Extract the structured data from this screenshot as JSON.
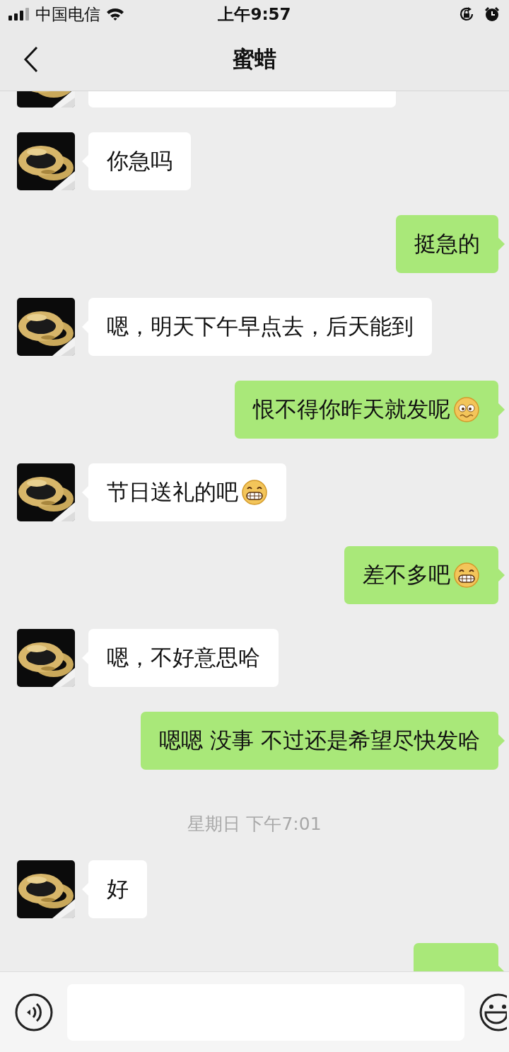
{
  "status_bar": {
    "carrier": "中国电信",
    "time": "上午9:57"
  },
  "nav": {
    "title": "蜜蜡"
  },
  "messages": [
    {
      "kind": "partial-in"
    },
    {
      "kind": "incoming",
      "text": "你急吗"
    },
    {
      "kind": "outgoing",
      "text": "挺急的"
    },
    {
      "kind": "incoming",
      "text": "嗯，明天下午早点去，后天能到"
    },
    {
      "kind": "outgoing",
      "text": "恨不得你昨天就发呢",
      "emoji": {
        "kind": "worried"
      }
    },
    {
      "kind": "incoming",
      "text": "节日送礼的吧",
      "emoji": {
        "kind": "grin"
      }
    },
    {
      "kind": "outgoing",
      "text": "差不多吧",
      "emoji": {
        "kind": "grin"
      }
    },
    {
      "kind": "incoming",
      "text": "嗯，不好意思哈"
    },
    {
      "kind": "outgoing",
      "text": "嗯嗯 没事 不过还是希望尽快发哈"
    },
    {
      "kind": "time",
      "text": "星期日 下午7:01"
    },
    {
      "kind": "incoming",
      "text": "好"
    },
    {
      "kind": "partial-out"
    }
  ]
}
